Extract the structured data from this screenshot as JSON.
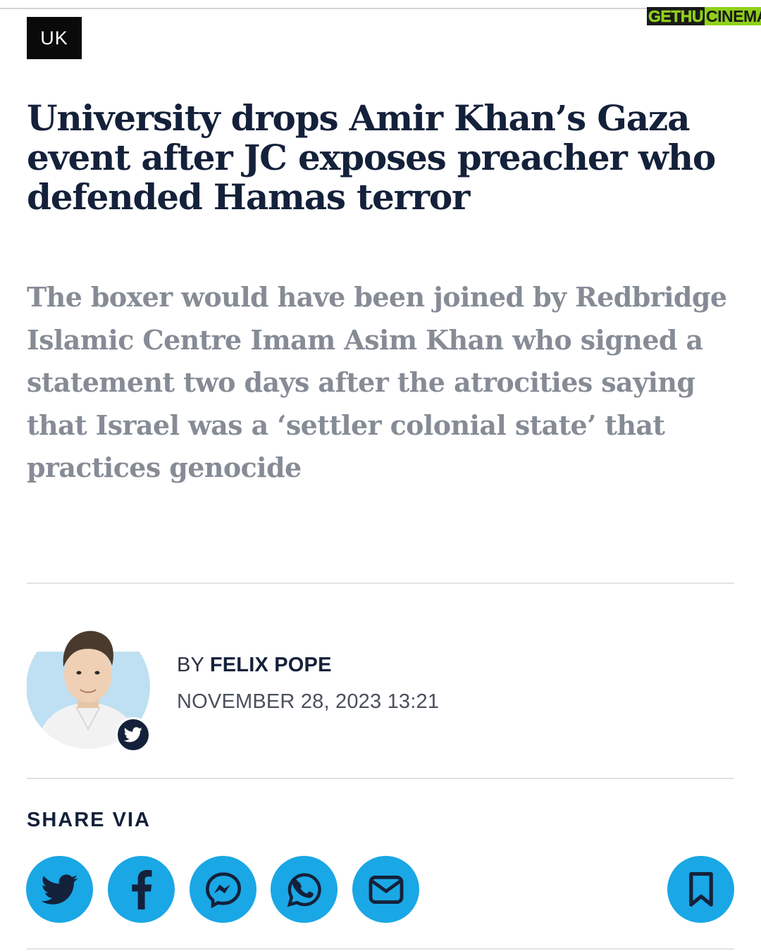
{
  "watermark": {
    "part1": "GETHU",
    "part2": "CINEMA"
  },
  "category": "UK",
  "headline": "University drops Amir Khan’s Gaza event after JC exposes preacher who defended Hamas terror",
  "standfirst": "The boxer would have been joined by Redbridge Islamic Centre Imam Asim Khan who signed a statement two days after the atrocities saying that Israel was a ‘settler colonial state’ that practices genocide",
  "byline": {
    "prefix": "BY ",
    "author": "FELIX POPE",
    "date": "NOVEMBER 28, 2023 13:21"
  },
  "share": {
    "label": "SHARE VIA",
    "buttons": [
      {
        "icon": "twitter-icon"
      },
      {
        "icon": "facebook-icon"
      },
      {
        "icon": "messenger-icon"
      },
      {
        "icon": "whatsapp-icon"
      },
      {
        "icon": "email-icon"
      },
      {
        "icon": "bookmark-icon"
      }
    ]
  },
  "colors": {
    "headline": "#14213a",
    "standfirst": "#868c96",
    "share_button": "#1aa7e5",
    "tag_background": "#0a0a0a",
    "avatar_background": "#bfe0f2"
  }
}
